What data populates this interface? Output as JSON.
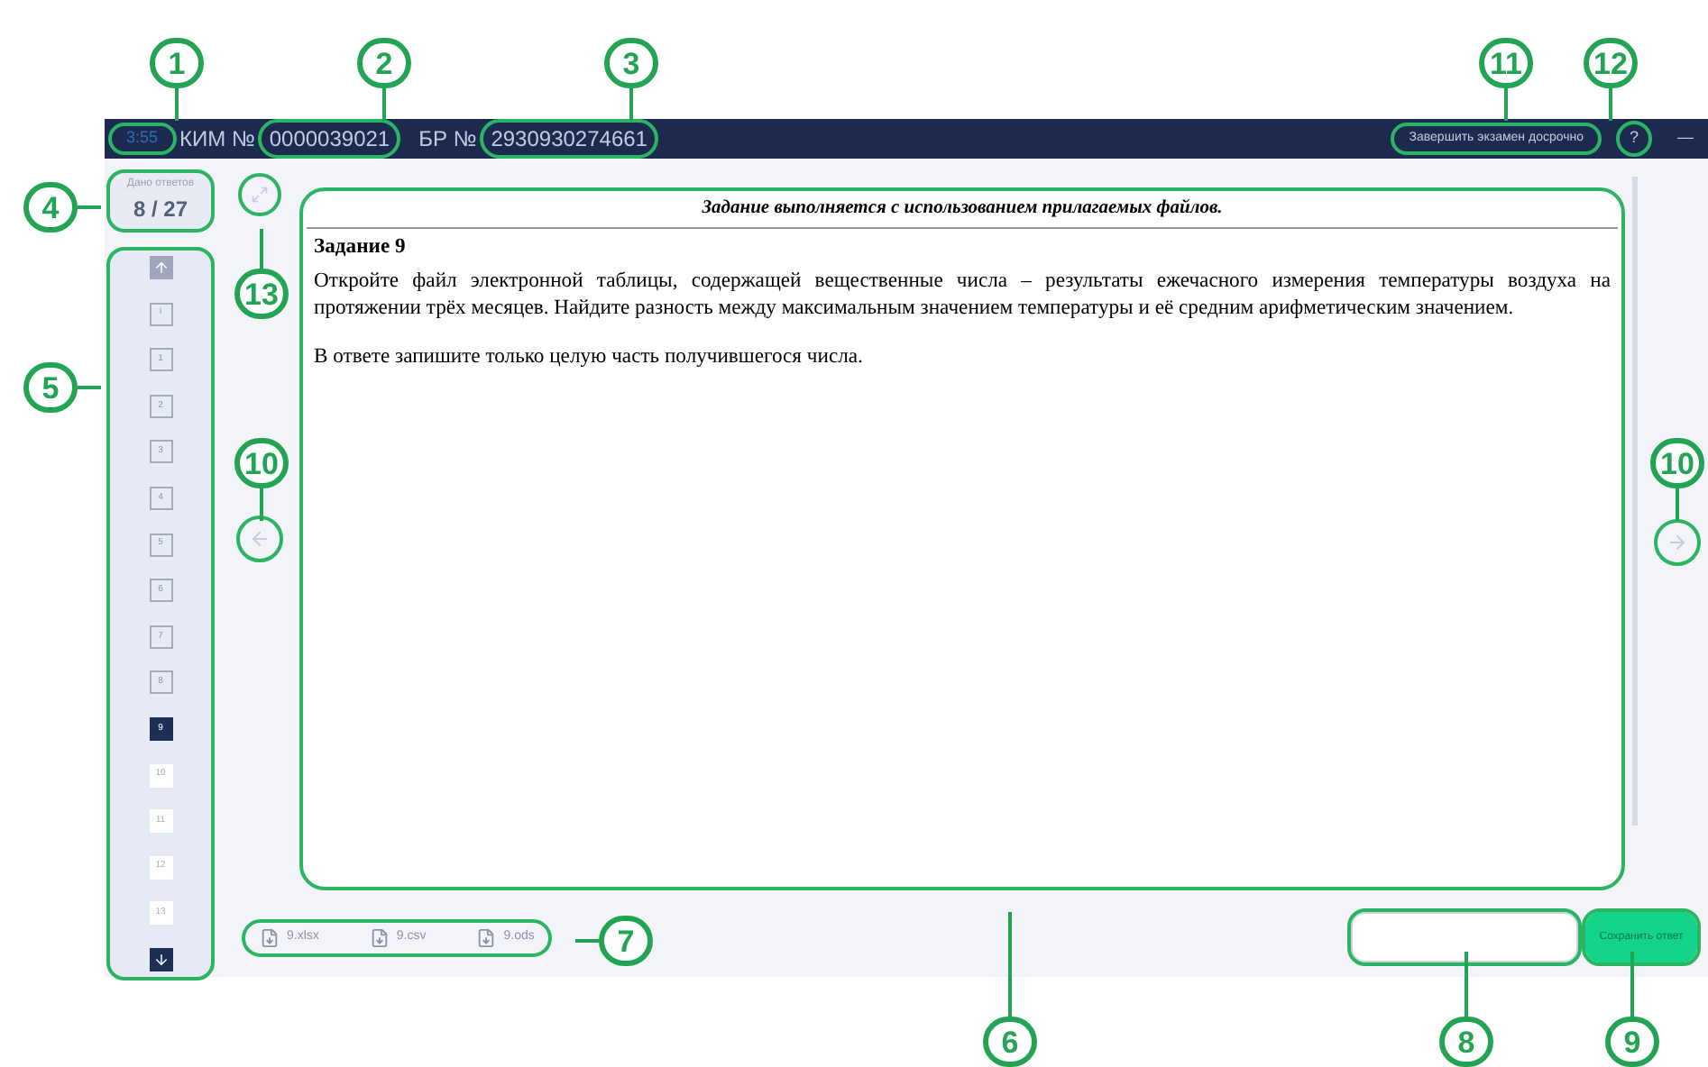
{
  "header": {
    "timer": "3:55",
    "kim_label": "КИМ №",
    "kim_number": "0000039021",
    "br_label": "БР №",
    "br_number": "2930930274661",
    "finish_button": "Завершить экзамен досрочно",
    "help_button": "?",
    "minimize_button": "—"
  },
  "progress": {
    "label": "Дано ответов",
    "value": "8 / 27"
  },
  "nav": [
    {
      "label": "i",
      "selected": false,
      "answered": true
    },
    {
      "label": "1",
      "selected": false,
      "answered": true
    },
    {
      "label": "2",
      "selected": false,
      "answered": true
    },
    {
      "label": "3",
      "selected": false,
      "answered": true
    },
    {
      "label": "4",
      "selected": false,
      "answered": true
    },
    {
      "label": "5",
      "selected": false,
      "answered": true
    },
    {
      "label": "6",
      "selected": false,
      "answered": true
    },
    {
      "label": "7",
      "selected": false,
      "answered": true
    },
    {
      "label": "8",
      "selected": false,
      "answered": true
    },
    {
      "label": "9",
      "selected": true,
      "answered": false
    },
    {
      "label": "10",
      "selected": false,
      "answered": false
    },
    {
      "label": "11",
      "selected": false,
      "answered": false
    },
    {
      "label": "12",
      "selected": false,
      "answered": false
    },
    {
      "label": "13",
      "selected": false,
      "answered": false
    }
  ],
  "task": {
    "banner": "Задание выполняется с использованием прилагаемых файлов.",
    "title": "Задание 9",
    "paragraphs": [
      "Откройте файл электронной таблицы, содержащей вещественные числа – результаты ежечасного измерения температуры воздуха на протяжении трёх месяцев. Найдите разность между максимальным значением температуры и её средним арифметическим значением.",
      "В ответе запишите только целую часть получившегося числа."
    ]
  },
  "files": [
    {
      "name": "9.xlsx"
    },
    {
      "name": "9.csv"
    },
    {
      "name": "9.ods"
    }
  ],
  "save_button": "Сохранить ответ",
  "callouts": [
    {
      "label": "1"
    },
    {
      "label": "2"
    },
    {
      "label": "3"
    },
    {
      "label": "11"
    },
    {
      "label": "12"
    },
    {
      "label": "4"
    },
    {
      "label": "5"
    },
    {
      "label": "13"
    },
    {
      "label": "10"
    },
    {
      "label": "10"
    },
    {
      "label": "6"
    },
    {
      "label": "7"
    },
    {
      "label": "8"
    },
    {
      "label": "9"
    }
  ]
}
